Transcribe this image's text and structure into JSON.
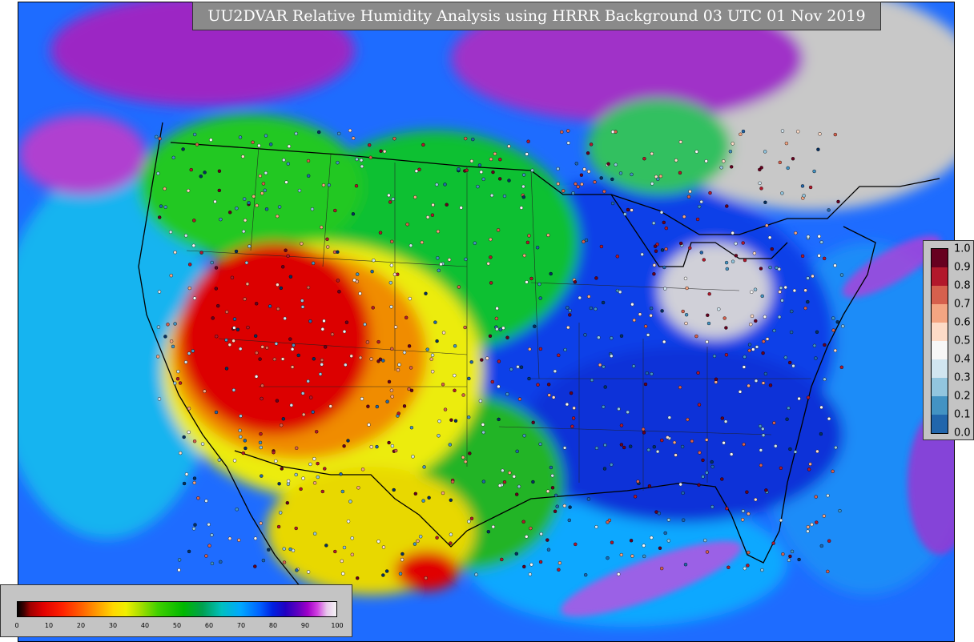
{
  "map": {
    "title": "UU2DVAR Relative Humidity Analysis using HRRR Background 03 UTC 01 Nov 2019",
    "region": "CONUS",
    "field": "Relative Humidity",
    "colors": {
      "dry_red": "#d40000",
      "orange": "#f07800",
      "yellow": "#e8e800",
      "green": "#00b400",
      "cyan": "#00b4ff",
      "blue": "#0030e0",
      "purple": "#a000c8",
      "gray": "#c8c8c8",
      "coast": "#000000"
    }
  },
  "rh_legend": {
    "ticks": [
      "0",
      "10",
      "20",
      "30",
      "40",
      "50",
      "60",
      "70",
      "80",
      "90",
      "100"
    ]
  },
  "obs_legend": {
    "ticks": [
      "1.0",
      "0.9",
      "0.8",
      "0.7",
      "0.6",
      "0.5",
      "0.4",
      "0.3",
      "0.2",
      "0.1",
      "0.0"
    ],
    "colors": [
      "#67001f",
      "#b2182b",
      "#d6604d",
      "#f4a582",
      "#fddbc7",
      "#f7f7f7",
      "#d1e5f0",
      "#92c5de",
      "#4393c3",
      "#2166ac",
      "#053061"
    ]
  }
}
